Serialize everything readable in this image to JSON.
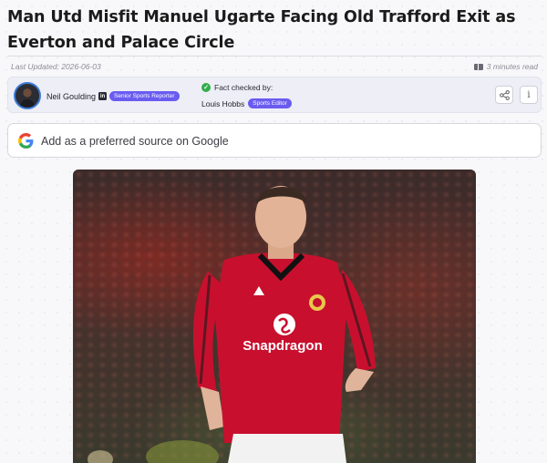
{
  "article": {
    "headline": "Man Utd Misfit Manuel Ugarte Facing Old Trafford Exit as Everton and Palace Circle",
    "last_updated": "Last Updated: 2026-06-03",
    "read_time": "3 minutes read"
  },
  "author": {
    "name": "Neil Goulding",
    "linkedin_glyph": "in",
    "role_badge": "Senior Sports Reporter"
  },
  "fact_check": {
    "label": "Fact checked by:",
    "name": "Louis Hobbs",
    "role_badge": "Sports Editor"
  },
  "actions": {
    "share_icon": "share-icon",
    "info_label": "i"
  },
  "google_source": {
    "text": "Add as a preferred source on Google"
  },
  "hero_image": {
    "shirt_sponsor": "Snapdragon"
  },
  "colors": {
    "badge": "#6a5cf0",
    "check": "#2fae4a",
    "shirt": "#c8102e"
  }
}
